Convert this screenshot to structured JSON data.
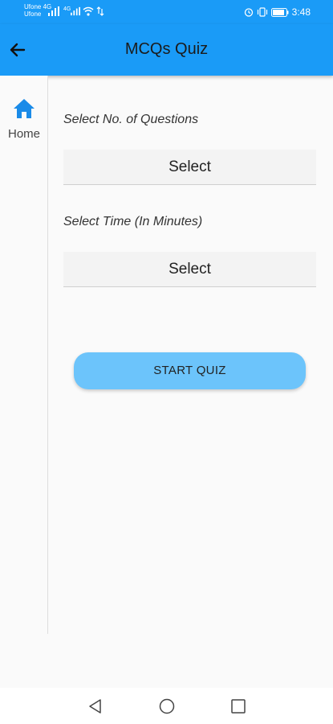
{
  "status_bar": {
    "carrier_1": "Ufone",
    "carrier_1_tech": "4G",
    "carrier_2": "Ufone",
    "carrier_2_tech": "4G",
    "time": "3:48",
    "icons": [
      "signal-icon",
      "wifi-icon",
      "alarm-icon",
      "vibrate-icon",
      "battery-icon"
    ]
  },
  "app_bar": {
    "title": "MCQs Quiz",
    "back_icon": "arrow-left-icon"
  },
  "side_rail": {
    "items": [
      {
        "label": "Home",
        "icon": "home-icon"
      }
    ]
  },
  "form": {
    "questions_label": "Select No. of Questions",
    "questions_value": "Select",
    "time_label": "Select Time (In Minutes)",
    "time_value": "Select",
    "start_button": "START QUIZ"
  },
  "nav_bar": {
    "icons": [
      "nav-back-icon",
      "nav-home-icon",
      "nav-recents-icon"
    ]
  },
  "colors": {
    "primary": "#1a9bf7",
    "button": "#6cc4fb",
    "home_icon": "#1a8be8"
  }
}
